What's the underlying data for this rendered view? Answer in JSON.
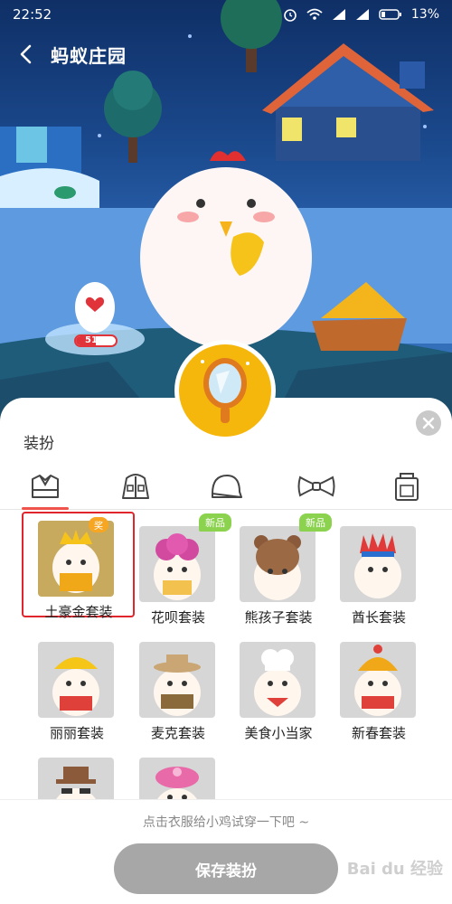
{
  "status_bar": {
    "time": "22:52",
    "battery": "13%"
  },
  "header": {
    "title": "蚂蚁庄园"
  },
  "egg": {
    "progress_label": "51%",
    "progress": 0.51
  },
  "panel": {
    "title": "装扮",
    "tabs": [
      {
        "icon": "shirt-icon",
        "active": true
      },
      {
        "icon": "jacket-icon",
        "active": false
      },
      {
        "icon": "cap-icon",
        "active": false
      },
      {
        "icon": "bowtie-icon",
        "active": false
      },
      {
        "icon": "bag-icon",
        "active": false
      }
    ],
    "outfits": [
      {
        "name": "土豪金套装",
        "tag": "奖",
        "selected": true
      },
      {
        "name": "花呗套装",
        "tag": "新品"
      },
      {
        "name": "熊孩子套装",
        "tag": "新品"
      },
      {
        "name": "酋长套装"
      },
      {
        "name": "丽丽套装"
      },
      {
        "name": "麦克套装"
      },
      {
        "name": "美食小当家"
      },
      {
        "name": "新春套装"
      },
      {
        "name": ""
      },
      {
        "name": ""
      }
    ],
    "hint": "点击衣服给小鸡试穿一下吧 ~",
    "save_label": "保存装扮"
  },
  "watermark": "Bai du 经验",
  "colors": {
    "accent": "#f0524c",
    "selected_border": "#e0252c",
    "new_tag": "#8bd24e",
    "prize_tag": "#f6a623",
    "mirror": "#f6b70d"
  }
}
